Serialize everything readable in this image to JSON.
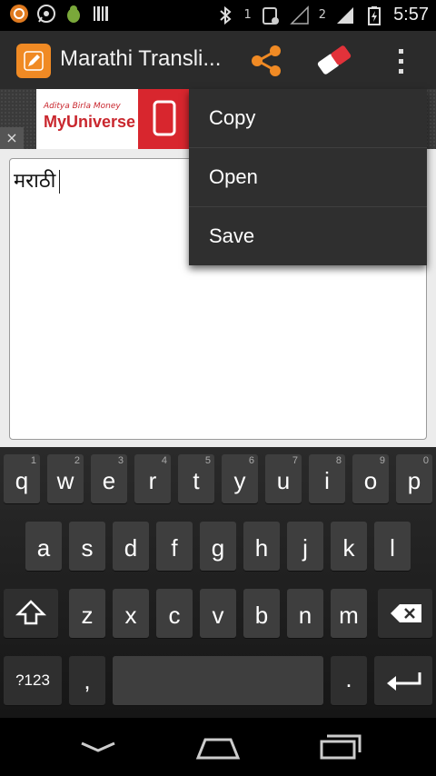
{
  "status_bar": {
    "time": "5:57",
    "left_icons": [
      "app-notification-icon",
      "whatsapp-icon",
      "android-debug-icon",
      "barcode-icon"
    ],
    "right_icons": [
      "bluetooth-icon",
      "sim1-signal-icon",
      "sim2-signal-icon",
      "battery-charging-icon"
    ],
    "sim1_label": "1",
    "sim2_label": "2"
  },
  "action_bar": {
    "title": "Marathi Transli...",
    "accent_color": "#f08a24"
  },
  "ad": {
    "small_text": "Aditya Birla Money",
    "brand_text": "MyUniverse",
    "close_label": "×"
  },
  "editor": {
    "text": "मराठी"
  },
  "menu": {
    "items": [
      {
        "label": "Copy"
      },
      {
        "label": "Open"
      },
      {
        "label": "Save"
      }
    ]
  },
  "keyboard": {
    "row1": [
      {
        "label": "q",
        "hint": "1"
      },
      {
        "label": "w",
        "hint": "2"
      },
      {
        "label": "e",
        "hint": "3"
      },
      {
        "label": "r",
        "hint": "4"
      },
      {
        "label": "t",
        "hint": "5"
      },
      {
        "label": "y",
        "hint": "6"
      },
      {
        "label": "u",
        "hint": "7"
      },
      {
        "label": "i",
        "hint": "8"
      },
      {
        "label": "o",
        "hint": "9"
      },
      {
        "label": "p",
        "hint": "0"
      }
    ],
    "row2": [
      "a",
      "s",
      "d",
      "f",
      "g",
      "h",
      "j",
      "k",
      "l"
    ],
    "row3": [
      "z",
      "x",
      "c",
      "v",
      "b",
      "n",
      "m"
    ],
    "symbols_label": "?123",
    "comma_label": ",",
    "period_label": "."
  },
  "nav_bar": {
    "icons": [
      "back-icon",
      "home-icon",
      "recent-apps-icon"
    ]
  }
}
